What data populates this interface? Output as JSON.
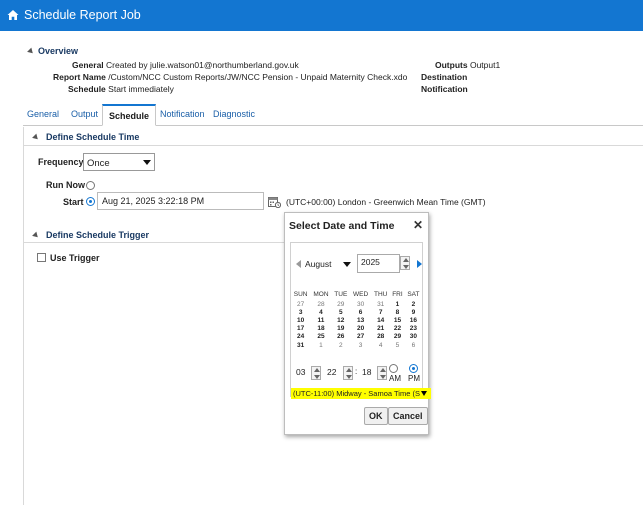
{
  "header": {
    "title": "Schedule Report Job"
  },
  "overview": {
    "heading": "Overview",
    "general_label": "General",
    "general_value": "Created by julie.watson01@northumberland.gov.uk",
    "report_name_label": "Report Name",
    "report_name_value": "/Custom/NCC Custom Reports/JW/NCC Pension - Unpaid Maternity Check.xdo",
    "schedule_label": "Schedule",
    "schedule_value": "Start immediately",
    "outputs_label": "Outputs",
    "outputs_value": "Output1",
    "destination_label": "Destination",
    "notification_label": "Notification"
  },
  "tabs": [
    "General",
    "Output",
    "Schedule",
    "Notification",
    "Diagnostic"
  ],
  "active_tab": "Schedule",
  "schedule_time": {
    "heading": "Define Schedule Time",
    "frequency_label": "Frequency",
    "frequency_value": "Once",
    "run_now_label": "Run Now",
    "start_label": "Start",
    "start_value": "Aug 21, 2025 3:22:18 PM",
    "timezone": "(UTC+00:00) London - Greenwich Mean Time (GMT)"
  },
  "schedule_trigger": {
    "heading": "Define Schedule Trigger",
    "use_trigger_label": "Use Trigger"
  },
  "date_dialog": {
    "title": "Select Date and Time",
    "month": "August",
    "year": "2025",
    "weekdays": [
      "SUN",
      "MON",
      "TUE",
      "WED",
      "THU",
      "FRI",
      "SAT"
    ],
    "weeks": [
      [
        "27",
        "28",
        "29",
        "30",
        "31",
        "1",
        "2"
      ],
      [
        "3",
        "4",
        "5",
        "6",
        "7",
        "8",
        "9"
      ],
      [
        "10",
        "11",
        "12",
        "13",
        "14",
        "15",
        "16"
      ],
      [
        "17",
        "18",
        "19",
        "20",
        "21",
        "22",
        "23"
      ],
      [
        "24",
        "25",
        "26",
        "27",
        "28",
        "29",
        "30"
      ],
      [
        "31",
        "1",
        "2",
        "3",
        "4",
        "5",
        "6"
      ]
    ],
    "hour": "03",
    "minute": "22",
    "second": "18",
    "am_label": "AM",
    "pm_label": "PM",
    "timezone": "(UTC-11:00) Midway - Samoa Time (S",
    "ok_label": "OK",
    "cancel_label": "Cancel",
    "accent": "#1376d1",
    "highlight": "#ffff00"
  }
}
